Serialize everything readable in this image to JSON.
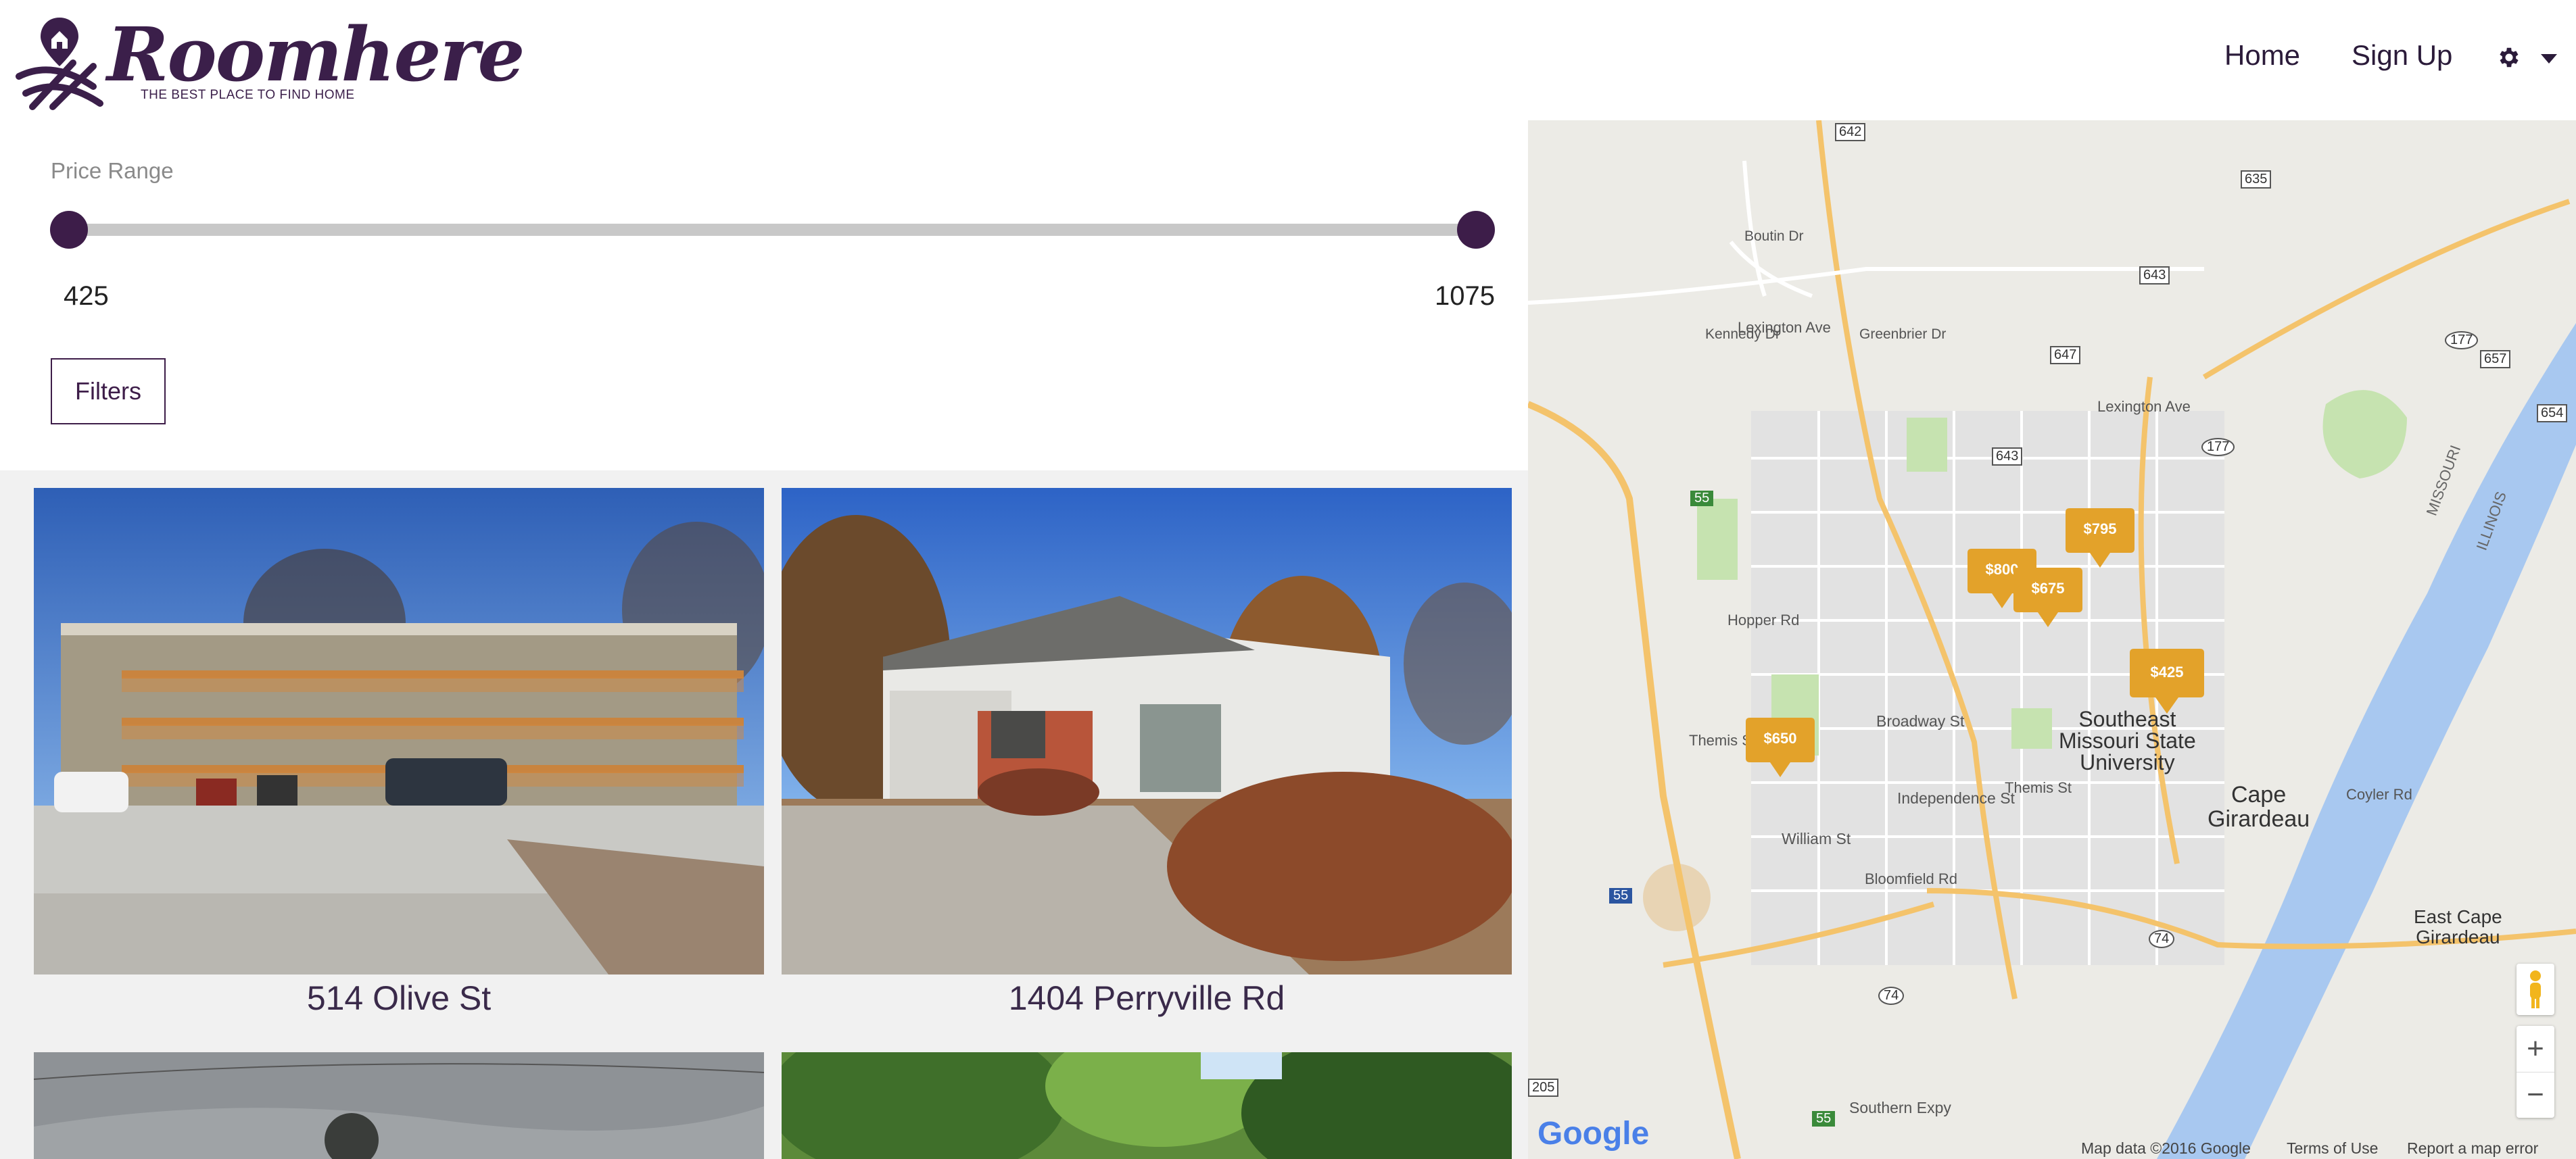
{
  "brand": {
    "name": "Roomhere",
    "tagline": "THE BEST PLACE TO FIND HOME",
    "color": "#3b1f4a"
  },
  "nav": {
    "home": "Home",
    "signup": "Sign Up",
    "settings_icon": "gear-icon"
  },
  "filters": {
    "price_label": "Price Range",
    "min": "425",
    "max": "1075",
    "button": "Filters"
  },
  "listings": [
    {
      "address": "514 Olive St"
    },
    {
      "address": "1404 Perryville Rd"
    }
  ],
  "map": {
    "pins": [
      "$795",
      "$800",
      "$675",
      "$425",
      "$650"
    ],
    "labels": {
      "university": [
        "Southeast",
        "Missouri State",
        "University"
      ],
      "city": [
        "Cape",
        "Girardeau"
      ],
      "east_city": [
        "East Cape",
        "Girardeau"
      ],
      "roads": {
        "lexington1": "Lexington Ave",
        "lexington2": "Lexington Ave",
        "broadway": "Broadway St",
        "independence": "Independence St",
        "william": "William St",
        "bloomfield": "Bloomfield Rd",
        "themis": "Themis St",
        "themis2": "Themis St",
        "hopper": "Hopper Rd",
        "kennedy": "Kennedy Dr",
        "greenbrier": "Greenbrier Dr",
        "boutin": "Boutin Dr",
        "coyler": "Coyler Rd",
        "southern": "Southern Expy",
        "missouri": "MISSOURI",
        "illinois": "ILLINOIS"
      },
      "shields": [
        "642",
        "635",
        "643",
        "647",
        "643",
        "177",
        "657",
        "654",
        "177",
        "55",
        "55",
        "74",
        "74",
        "205",
        "55"
      ]
    },
    "google": "Google",
    "footer": {
      "data": "Map data ©2016 Google",
      "terms": "Terms of Use",
      "report": "Report a map error"
    },
    "zoom_in": "+",
    "zoom_out": "−"
  }
}
